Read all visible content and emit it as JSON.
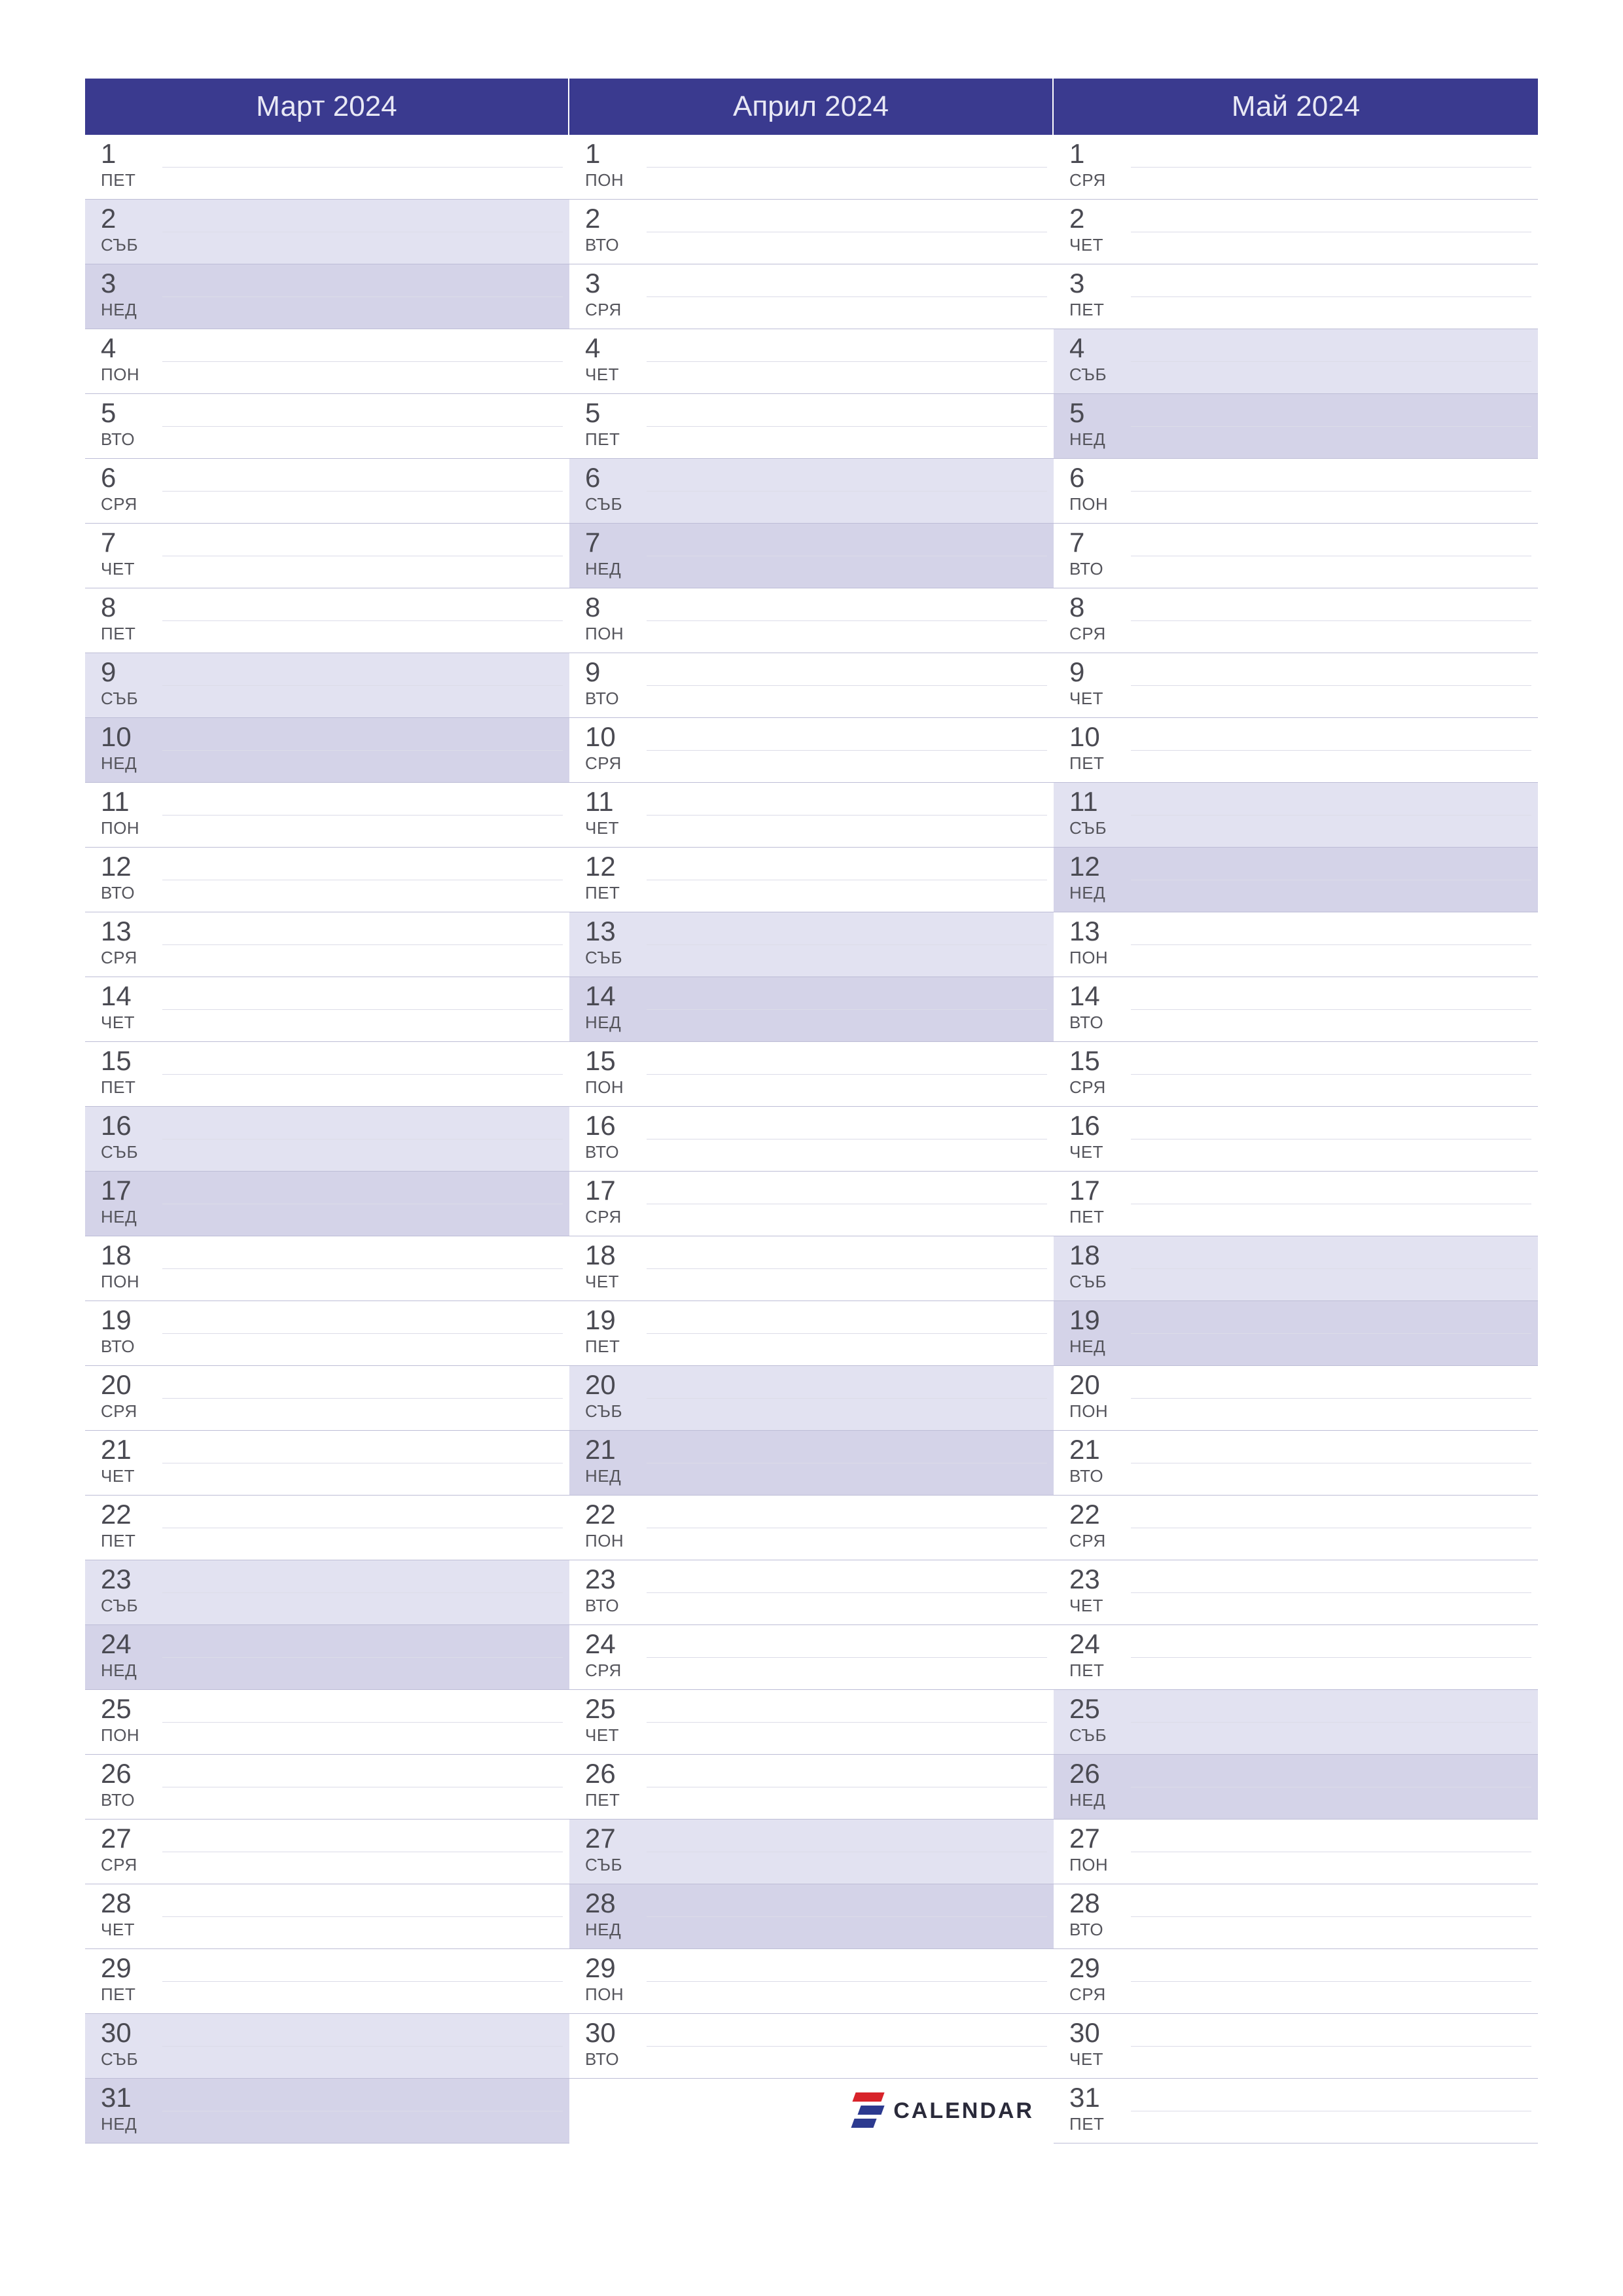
{
  "logo_text": "CALENDAR",
  "months": [
    {
      "title": "Март 2024",
      "days": [
        {
          "num": "1",
          "name": "ПЕТ",
          "type": "weekday"
        },
        {
          "num": "2",
          "name": "СЪБ",
          "type": "sat"
        },
        {
          "num": "3",
          "name": "НЕД",
          "type": "sun"
        },
        {
          "num": "4",
          "name": "ПОН",
          "type": "weekday"
        },
        {
          "num": "5",
          "name": "ВТО",
          "type": "weekday"
        },
        {
          "num": "6",
          "name": "СРЯ",
          "type": "weekday"
        },
        {
          "num": "7",
          "name": "ЧЕТ",
          "type": "weekday"
        },
        {
          "num": "8",
          "name": "ПЕТ",
          "type": "weekday"
        },
        {
          "num": "9",
          "name": "СЪБ",
          "type": "sat"
        },
        {
          "num": "10",
          "name": "НЕД",
          "type": "sun"
        },
        {
          "num": "11",
          "name": "ПОН",
          "type": "weekday"
        },
        {
          "num": "12",
          "name": "ВТО",
          "type": "weekday"
        },
        {
          "num": "13",
          "name": "СРЯ",
          "type": "weekday"
        },
        {
          "num": "14",
          "name": "ЧЕТ",
          "type": "weekday"
        },
        {
          "num": "15",
          "name": "ПЕТ",
          "type": "weekday"
        },
        {
          "num": "16",
          "name": "СЪБ",
          "type": "sat"
        },
        {
          "num": "17",
          "name": "НЕД",
          "type": "sun"
        },
        {
          "num": "18",
          "name": "ПОН",
          "type": "weekday"
        },
        {
          "num": "19",
          "name": "ВТО",
          "type": "weekday"
        },
        {
          "num": "20",
          "name": "СРЯ",
          "type": "weekday"
        },
        {
          "num": "21",
          "name": "ЧЕТ",
          "type": "weekday"
        },
        {
          "num": "22",
          "name": "ПЕТ",
          "type": "weekday"
        },
        {
          "num": "23",
          "name": "СЪБ",
          "type": "sat"
        },
        {
          "num": "24",
          "name": "НЕД",
          "type": "sun"
        },
        {
          "num": "25",
          "name": "ПОН",
          "type": "weekday"
        },
        {
          "num": "26",
          "name": "ВТО",
          "type": "weekday"
        },
        {
          "num": "27",
          "name": "СРЯ",
          "type": "weekday"
        },
        {
          "num": "28",
          "name": "ЧЕТ",
          "type": "weekday"
        },
        {
          "num": "29",
          "name": "ПЕТ",
          "type": "weekday"
        },
        {
          "num": "30",
          "name": "СЪБ",
          "type": "sat"
        },
        {
          "num": "31",
          "name": "НЕД",
          "type": "sun"
        }
      ]
    },
    {
      "title": "Април 2024",
      "days": [
        {
          "num": "1",
          "name": "ПОН",
          "type": "weekday"
        },
        {
          "num": "2",
          "name": "ВТО",
          "type": "weekday"
        },
        {
          "num": "3",
          "name": "СРЯ",
          "type": "weekday"
        },
        {
          "num": "4",
          "name": "ЧЕТ",
          "type": "weekday"
        },
        {
          "num": "5",
          "name": "ПЕТ",
          "type": "weekday"
        },
        {
          "num": "6",
          "name": "СЪБ",
          "type": "sat"
        },
        {
          "num": "7",
          "name": "НЕД",
          "type": "sun"
        },
        {
          "num": "8",
          "name": "ПОН",
          "type": "weekday"
        },
        {
          "num": "9",
          "name": "ВТО",
          "type": "weekday"
        },
        {
          "num": "10",
          "name": "СРЯ",
          "type": "weekday"
        },
        {
          "num": "11",
          "name": "ЧЕТ",
          "type": "weekday"
        },
        {
          "num": "12",
          "name": "ПЕТ",
          "type": "weekday"
        },
        {
          "num": "13",
          "name": "СЪБ",
          "type": "sat"
        },
        {
          "num": "14",
          "name": "НЕД",
          "type": "sun"
        },
        {
          "num": "15",
          "name": "ПОН",
          "type": "weekday"
        },
        {
          "num": "16",
          "name": "ВТО",
          "type": "weekday"
        },
        {
          "num": "17",
          "name": "СРЯ",
          "type": "weekday"
        },
        {
          "num": "18",
          "name": "ЧЕТ",
          "type": "weekday"
        },
        {
          "num": "19",
          "name": "ПЕТ",
          "type": "weekday"
        },
        {
          "num": "20",
          "name": "СЪБ",
          "type": "sat"
        },
        {
          "num": "21",
          "name": "НЕД",
          "type": "sun"
        },
        {
          "num": "22",
          "name": "ПОН",
          "type": "weekday"
        },
        {
          "num": "23",
          "name": "ВТО",
          "type": "weekday"
        },
        {
          "num": "24",
          "name": "СРЯ",
          "type": "weekday"
        },
        {
          "num": "25",
          "name": "ЧЕТ",
          "type": "weekday"
        },
        {
          "num": "26",
          "name": "ПЕТ",
          "type": "weekday"
        },
        {
          "num": "27",
          "name": "СЪБ",
          "type": "sat"
        },
        {
          "num": "28",
          "name": "НЕД",
          "type": "sun"
        },
        {
          "num": "29",
          "name": "ПОН",
          "type": "weekday"
        },
        {
          "num": "30",
          "name": "ВТО",
          "type": "weekday"
        }
      ]
    },
    {
      "title": "Май 2024",
      "days": [
        {
          "num": "1",
          "name": "СРЯ",
          "type": "weekday"
        },
        {
          "num": "2",
          "name": "ЧЕТ",
          "type": "weekday"
        },
        {
          "num": "3",
          "name": "ПЕТ",
          "type": "weekday"
        },
        {
          "num": "4",
          "name": "СЪБ",
          "type": "sat"
        },
        {
          "num": "5",
          "name": "НЕД",
          "type": "sun"
        },
        {
          "num": "6",
          "name": "ПОН",
          "type": "weekday"
        },
        {
          "num": "7",
          "name": "ВТО",
          "type": "weekday"
        },
        {
          "num": "8",
          "name": "СРЯ",
          "type": "weekday"
        },
        {
          "num": "9",
          "name": "ЧЕТ",
          "type": "weekday"
        },
        {
          "num": "10",
          "name": "ПЕТ",
          "type": "weekday"
        },
        {
          "num": "11",
          "name": "СЪБ",
          "type": "sat"
        },
        {
          "num": "12",
          "name": "НЕД",
          "type": "sun"
        },
        {
          "num": "13",
          "name": "ПОН",
          "type": "weekday"
        },
        {
          "num": "14",
          "name": "ВТО",
          "type": "weekday"
        },
        {
          "num": "15",
          "name": "СРЯ",
          "type": "weekday"
        },
        {
          "num": "16",
          "name": "ЧЕТ",
          "type": "weekday"
        },
        {
          "num": "17",
          "name": "ПЕТ",
          "type": "weekday"
        },
        {
          "num": "18",
          "name": "СЪБ",
          "type": "sat"
        },
        {
          "num": "19",
          "name": "НЕД",
          "type": "sun"
        },
        {
          "num": "20",
          "name": "ПОН",
          "type": "weekday"
        },
        {
          "num": "21",
          "name": "ВТО",
          "type": "weekday"
        },
        {
          "num": "22",
          "name": "СРЯ",
          "type": "weekday"
        },
        {
          "num": "23",
          "name": "ЧЕТ",
          "type": "weekday"
        },
        {
          "num": "24",
          "name": "ПЕТ",
          "type": "weekday"
        },
        {
          "num": "25",
          "name": "СЪБ",
          "type": "sat"
        },
        {
          "num": "26",
          "name": "НЕД",
          "type": "sun"
        },
        {
          "num": "27",
          "name": "ПОН",
          "type": "weekday"
        },
        {
          "num": "28",
          "name": "ВТО",
          "type": "weekday"
        },
        {
          "num": "29",
          "name": "СРЯ",
          "type": "weekday"
        },
        {
          "num": "30",
          "name": "ЧЕТ",
          "type": "weekday"
        },
        {
          "num": "31",
          "name": "ПЕТ",
          "type": "weekday"
        }
      ]
    }
  ]
}
